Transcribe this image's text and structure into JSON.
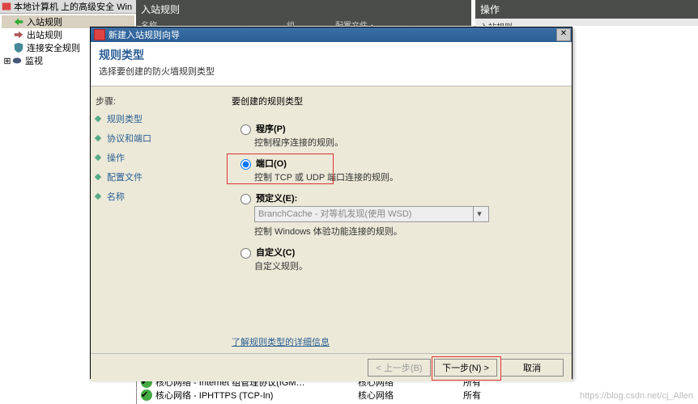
{
  "tree": {
    "root": "本地计算机 上的高级安全 Win",
    "items": [
      {
        "label": "入站规则",
        "selected": true
      },
      {
        "label": "出站规则"
      },
      {
        "label": "连接安全规则"
      },
      {
        "label": "监视"
      }
    ]
  },
  "main_header": {
    "title": "入站规则",
    "sub_name": "名称",
    "sub_group": "组",
    "sub_profile": "配置文件 ▴",
    "sub_status": "入站规则"
  },
  "ops_header": {
    "title": "操作",
    "sub": "入站规则"
  },
  "wizard": {
    "title": "新建入站规则向导",
    "header": {
      "h1": "规则类型",
      "h2": "选择要创建的防火墙规则类型"
    },
    "steps_label": "步骤:",
    "steps": [
      "规则类型",
      "协议和端口",
      "操作",
      "配置文件",
      "名称"
    ],
    "question": "要创建的规则类型",
    "options": {
      "program": {
        "title": "程序(P)",
        "desc": "控制程序连接的规则。"
      },
      "port": {
        "title": "端口(O)",
        "desc": "控制 TCP 或 UDP 端口连接的规则。"
      },
      "predefined": {
        "title": "预定义(E):",
        "desc": "控制 Windows 体验功能连接的规则。",
        "select": "BranchCache - 对等机发现(使用 WSD)"
      },
      "custom": {
        "title": "自定义(C)",
        "desc": "自定义规则。"
      }
    },
    "link": "了解规则类型的详细信息",
    "buttons": {
      "back": "< 上一步(B)",
      "next": "下一步(N) >",
      "cancel": "取消"
    }
  },
  "rules_list": [
    {
      "name": "核心网络 - Internet 组管理协议(IGM…",
      "group": "核心网络",
      "profile": "所有"
    },
    {
      "name": "核心网络 - IPHTTPS (TCP-In)",
      "group": "核心网络",
      "profile": "所有"
    }
  ],
  "watermark": "https://blog.csdn.net/cj_Allen"
}
